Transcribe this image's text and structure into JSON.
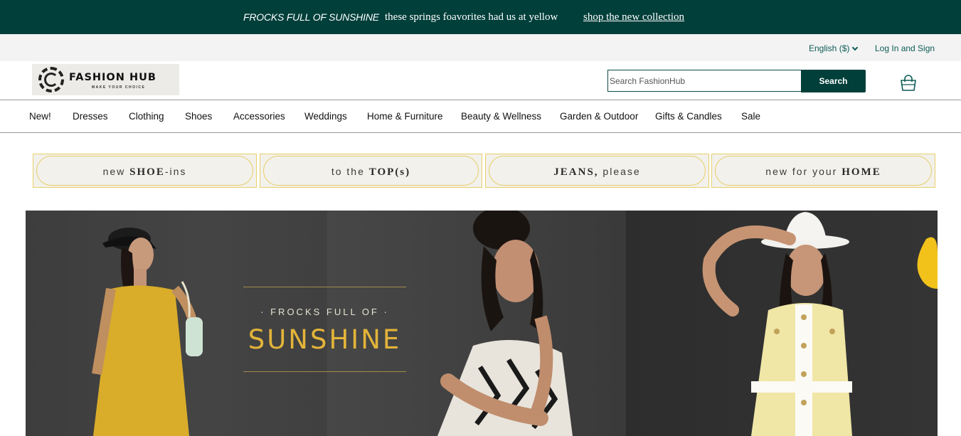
{
  "promo": {
    "title": "FROCKS FULL OF SUNSHINE",
    "text": "these springs foavorites had us at yellow",
    "link": "shop the new collection"
  },
  "utility": {
    "language": "English ($)",
    "login": "Log In and Sign"
  },
  "logo": {
    "brand": "FASHION HUB",
    "tagline": "MAKE YOUR CHOICE"
  },
  "search": {
    "placeholder": "Search FashionHub",
    "button": "Search"
  },
  "icons": {
    "cart": "shopping-bag-icon",
    "language_toggle": "chevron-down-icon"
  },
  "nav": {
    "items": [
      "New!",
      "Dresses",
      "Clothing",
      "Shoes",
      "Accessories",
      "Weddings",
      "Home & Furniture",
      "Beauty & Wellness",
      "Garden & Outdoor",
      "Gifts & Candles",
      "Sale"
    ]
  },
  "tiles": [
    {
      "pre": "new ",
      "bold": "SHOE",
      "post": "-ins"
    },
    {
      "pre": "to the ",
      "bold": "TOP(s)",
      "post": ""
    },
    {
      "pre": "",
      "bold": "JEANS,",
      "post": " please"
    },
    {
      "pre": "new for your ",
      "bold": "HOME",
      "post": ""
    }
  ],
  "hero": {
    "kicker": "· FROCKS FULL OF ·",
    "title": "SUNSHINE"
  },
  "colors": {
    "brand_green": "#003f3a",
    "accent_link": "#0d5c56",
    "gold": "#e3b43a",
    "tile_border": "#e6cf6a"
  }
}
